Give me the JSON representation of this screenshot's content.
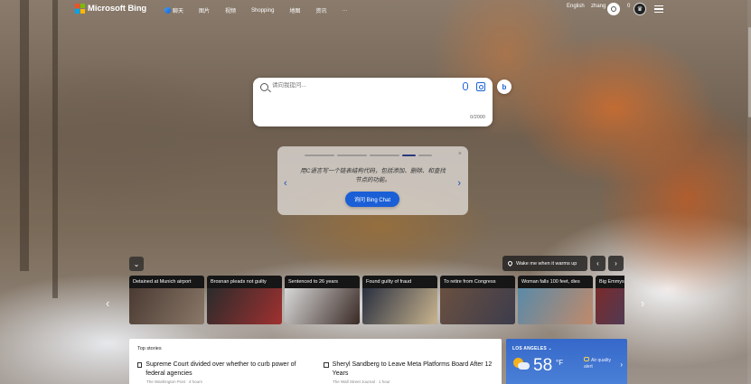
{
  "header": {
    "logo_text": "Microsoft Bing",
    "nav": [
      "聊天",
      "图片",
      "视频",
      "Shopping",
      "地图",
      "资讯",
      "···"
    ],
    "language": "English",
    "username": "zhang",
    "points": "0"
  },
  "search": {
    "placeholder": "请向我提问...",
    "char_count": "0/2000"
  },
  "promo": {
    "text": "用C语言写一个链表结构代码，包括添加、删除、和查找节点的功能。",
    "button_label": "询问 Bing Chat",
    "close": "×"
  },
  "carousel": {
    "wake_label": "Wake me when it warms up",
    "tiles": [
      {
        "title": "Detained at Munich airport",
        "color": "#5d4b3f"
      },
      {
        "title": "Brosnan pleads not guilty",
        "color": "#7a2020"
      },
      {
        "title": "Sentenced to 26 years",
        "color": "#3d3d3d"
      },
      {
        "title": "Found guilty of fraud",
        "color": "#4a4a55"
      },
      {
        "title": "To retire from Congress",
        "color": "#5a4035"
      },
      {
        "title": "Woman falls 100 feet, dies",
        "color": "#6a7a8a"
      },
      {
        "title": "Big Emmys",
        "color": "#8b3030"
      }
    ]
  },
  "feed": {
    "heading": "Top stories",
    "stories": [
      {
        "title": "Supreme Court divided over whether to curb power of federal agencies",
        "source": "The Washington Post · 4 hours"
      },
      {
        "title": "Sheryl Sandberg to Leave Meta Platforms Board After 12 Years",
        "source": "The Wall Street Journal · 1 hour"
      }
    ]
  },
  "weather": {
    "location": "LOS ANGELES",
    "temperature": "58",
    "unit": "°F",
    "air_quality": [
      "Air quality",
      "alert"
    ]
  },
  "colors": {
    "bing_blue": "#1a5fd6",
    "logo": [
      "#f25022",
      "#7fba00",
      "#00a4ef",
      "#ffb900"
    ]
  }
}
